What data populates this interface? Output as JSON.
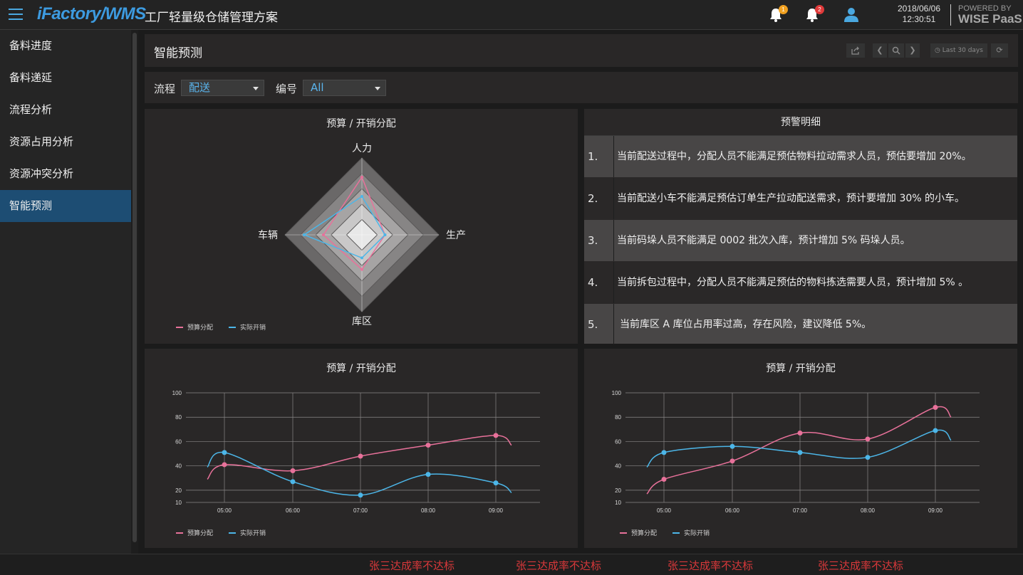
{
  "header": {
    "brand": "iFactory/WMS",
    "subtitle": "工厂轻量级仓储管理方案",
    "notif1_count": "1",
    "notif2_count": "2",
    "date": "2018/06/06",
    "time": "12:30:51",
    "powered_by": "POWERED BY",
    "powered_name": "WISE PaaS"
  },
  "sidebar": {
    "items": [
      {
        "label": "备料进度"
      },
      {
        "label": "备料递延"
      },
      {
        "label": "流程分析"
      },
      {
        "label": "资源占用分析"
      },
      {
        "label": "资源冲突分析"
      },
      {
        "label": "智能预测"
      }
    ],
    "active_index": 5
  },
  "page": {
    "title": "智能预测",
    "time_range": "Last 30 days"
  },
  "filters": {
    "process_label": "流程",
    "process_value": "配送",
    "number_label": "编号",
    "number_value": "All"
  },
  "colors": {
    "budget": "#e8719a",
    "actual": "#4cb6e8"
  },
  "radar": {
    "title": "预算 / 开销分配",
    "legend": [
      "预算分配",
      "实际开销"
    ]
  },
  "alerts": {
    "title": "预警明细",
    "rows": [
      {
        "num": "1.",
        "text": "当前配送过程中，分配人员不能满足预估物料拉动需求人员，预估要增加 20%。"
      },
      {
        "num": "2.",
        "text": "当前配送小车不能满足预估订单生产拉动配送需求，预计要增加 30% 的小车。"
      },
      {
        "num": "3.",
        "text": "当前码垛人员不能满足 0002 批次入库，预计增加 5% 码垛人员。"
      },
      {
        "num": "4.",
        "text": "当前拆包过程中，分配人员不能满足预估的物料拣选需要人员，预计增加 5% 。"
      },
      {
        "num": "5.",
        "text": "当前库区 A 库位占用率过高，存在风险，建议降低 5%。"
      }
    ]
  },
  "line_left": {
    "title": "预算 / 开销分配",
    "legend": [
      "预算分配",
      "实际开销"
    ]
  },
  "line_right": {
    "title": "预算 / 开销分配",
    "legend": [
      "预算分配",
      "实际开销"
    ]
  },
  "chart_data": [
    {
      "type": "radar",
      "title": "预算 / 开销分配",
      "axes": [
        "人力",
        "生产",
        "库区",
        "车辆"
      ],
      "max": 100,
      "series": [
        {
          "name": "预算分配",
          "values": [
            75,
            30,
            45,
            50
          ]
        },
        {
          "name": "实际开销",
          "values": [
            50,
            30,
            30,
            75
          ]
        }
      ]
    },
    {
      "type": "line",
      "title": "预算 / 开销分配",
      "categories": [
        "05:00",
        "06:00",
        "07:00",
        "08:00",
        "09:00"
      ],
      "ylim": [
        10,
        100
      ],
      "yticks": [
        10,
        20,
        40,
        60,
        80,
        100
      ],
      "series": [
        {
          "name": "预算分配",
          "values": [
            41,
            36,
            48,
            57,
            65
          ]
        },
        {
          "name": "实际开销",
          "values": [
            51,
            27,
            16,
            33,
            26
          ]
        }
      ]
    },
    {
      "type": "line",
      "title": "预算 / 开销分配",
      "categories": [
        "05:00",
        "06:00",
        "07:00",
        "08:00",
        "09:00"
      ],
      "ylim": [
        10,
        100
      ],
      "yticks": [
        10,
        20,
        40,
        60,
        80,
        100
      ],
      "series": [
        {
          "name": "预算分配",
          "values": [
            29,
            44,
            67,
            62,
            88
          ]
        },
        {
          "name": "实际开销",
          "values": [
            51,
            56,
            51,
            47,
            69
          ]
        }
      ]
    }
  ],
  "ticker": {
    "items": [
      "张三达成率不达标",
      "张三达成率不达标",
      "张三达成率不达标",
      "张三达成率不达标"
    ]
  }
}
